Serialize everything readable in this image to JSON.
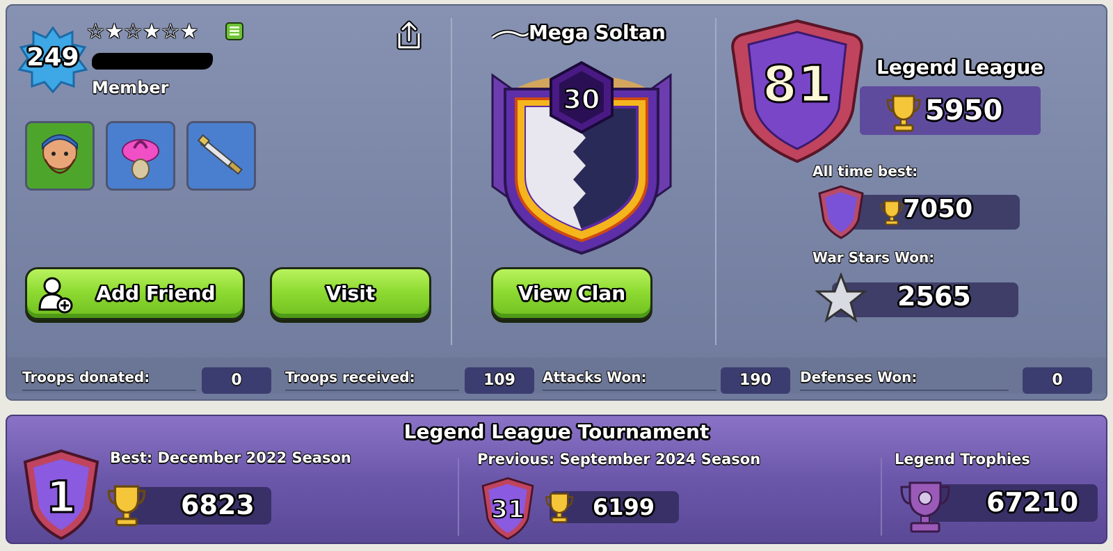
{
  "profile": {
    "level": "249",
    "stars": "☆★☆★☆★",
    "role": "Member",
    "skins": [
      "hero-builder",
      "pink-mushroom",
      "sword"
    ]
  },
  "buttons": {
    "add_friend": "Add Friend",
    "visit": "Visit",
    "view_clan": "View Clan"
  },
  "clan": {
    "name": "Mega Soltan",
    "level": "30"
  },
  "league": {
    "rank": "81",
    "name": "Legend League",
    "trophies": "5950",
    "all_time_best_label": "All time best:",
    "all_time_best": "7050",
    "war_stars_label": "War Stars Won:",
    "war_stars": "2565"
  },
  "stats": [
    {
      "label": "Troops donated:",
      "value": "0"
    },
    {
      "label": "Troops received:",
      "value": "109"
    },
    {
      "label": "Attacks Won:",
      "value": "190"
    },
    {
      "label": "Defenses Won:",
      "value": "0"
    }
  ],
  "tournament": {
    "title": "Legend League Tournament",
    "best_label": "Best: December 2022 Season",
    "best_rank": "1",
    "best_trophies": "6823",
    "previous_label": "Previous: September 2024 Season",
    "previous_rank": "31",
    "previous_trophies": "6199",
    "legend_label": "Legend Trophies",
    "legend_trophies": "67210"
  },
  "colors": {
    "top_panel": "#7b86a7",
    "bottom_panel": "#6b57aa",
    "green_button": "#8fdb33",
    "dark_box": "#3b3d70"
  }
}
